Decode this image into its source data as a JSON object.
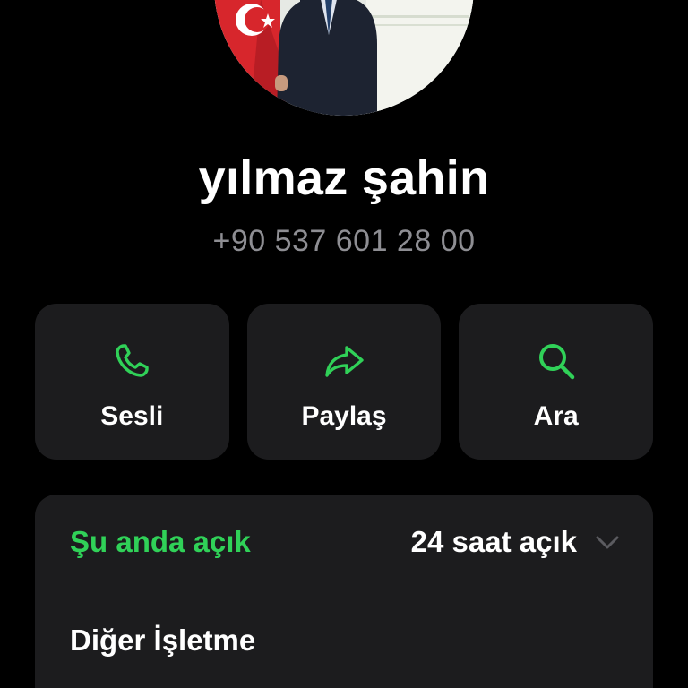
{
  "contact": {
    "name": "yılmaz şahin",
    "phone": "+90 537 601 28 00"
  },
  "actions": [
    {
      "label": "Sesli",
      "icon": "phone-icon"
    },
    {
      "label": "Paylaş",
      "icon": "share-arrow-icon"
    },
    {
      "label": "Ara",
      "icon": "search-icon"
    }
  ],
  "business": {
    "status": "Şu anda açık",
    "hours": "24 saat açık",
    "category": "Diğer İşletme"
  },
  "colors": {
    "accent": "#30d158",
    "background": "#000000",
    "card": "#1c1c1e",
    "secondary_text": "#8e8e93"
  }
}
